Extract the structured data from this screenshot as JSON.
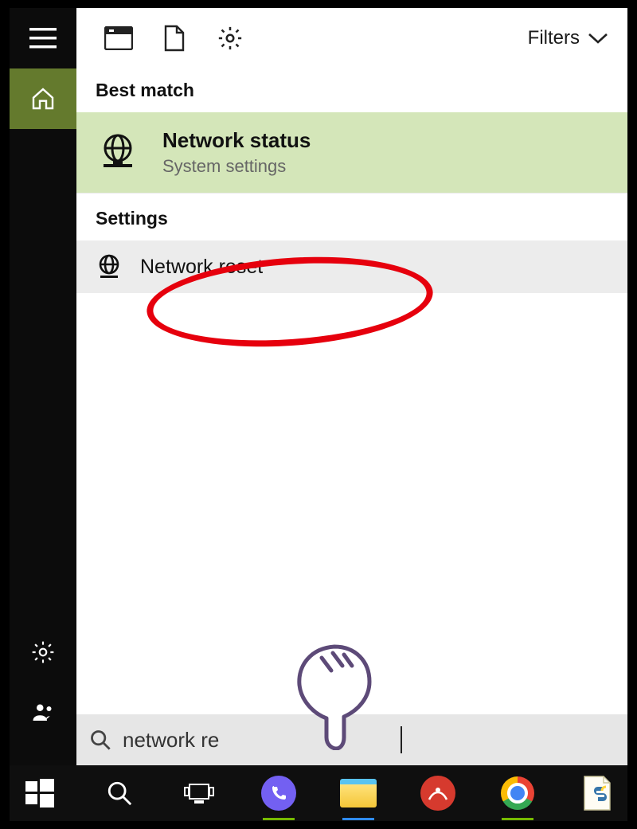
{
  "topbar": {
    "filters_label": "Filters"
  },
  "sections": {
    "best_match_label": "Best match",
    "settings_label": "Settings"
  },
  "best_match": {
    "title": "Network status",
    "subtitle": "System settings"
  },
  "settings_result": {
    "title": "Network reset"
  },
  "search": {
    "value": "network re",
    "placeholder": ""
  },
  "colors": {
    "sidebar_home_bg": "#647a2d",
    "best_match_bg": "#d4e6b9",
    "annotation_red": "#e6000d"
  },
  "taskbar": {
    "items": [
      {
        "name": "start"
      },
      {
        "name": "search"
      },
      {
        "name": "task-view"
      },
      {
        "name": "viber"
      },
      {
        "name": "file-explorer"
      },
      {
        "name": "app-red"
      },
      {
        "name": "chrome"
      },
      {
        "name": "python-doc"
      }
    ]
  }
}
